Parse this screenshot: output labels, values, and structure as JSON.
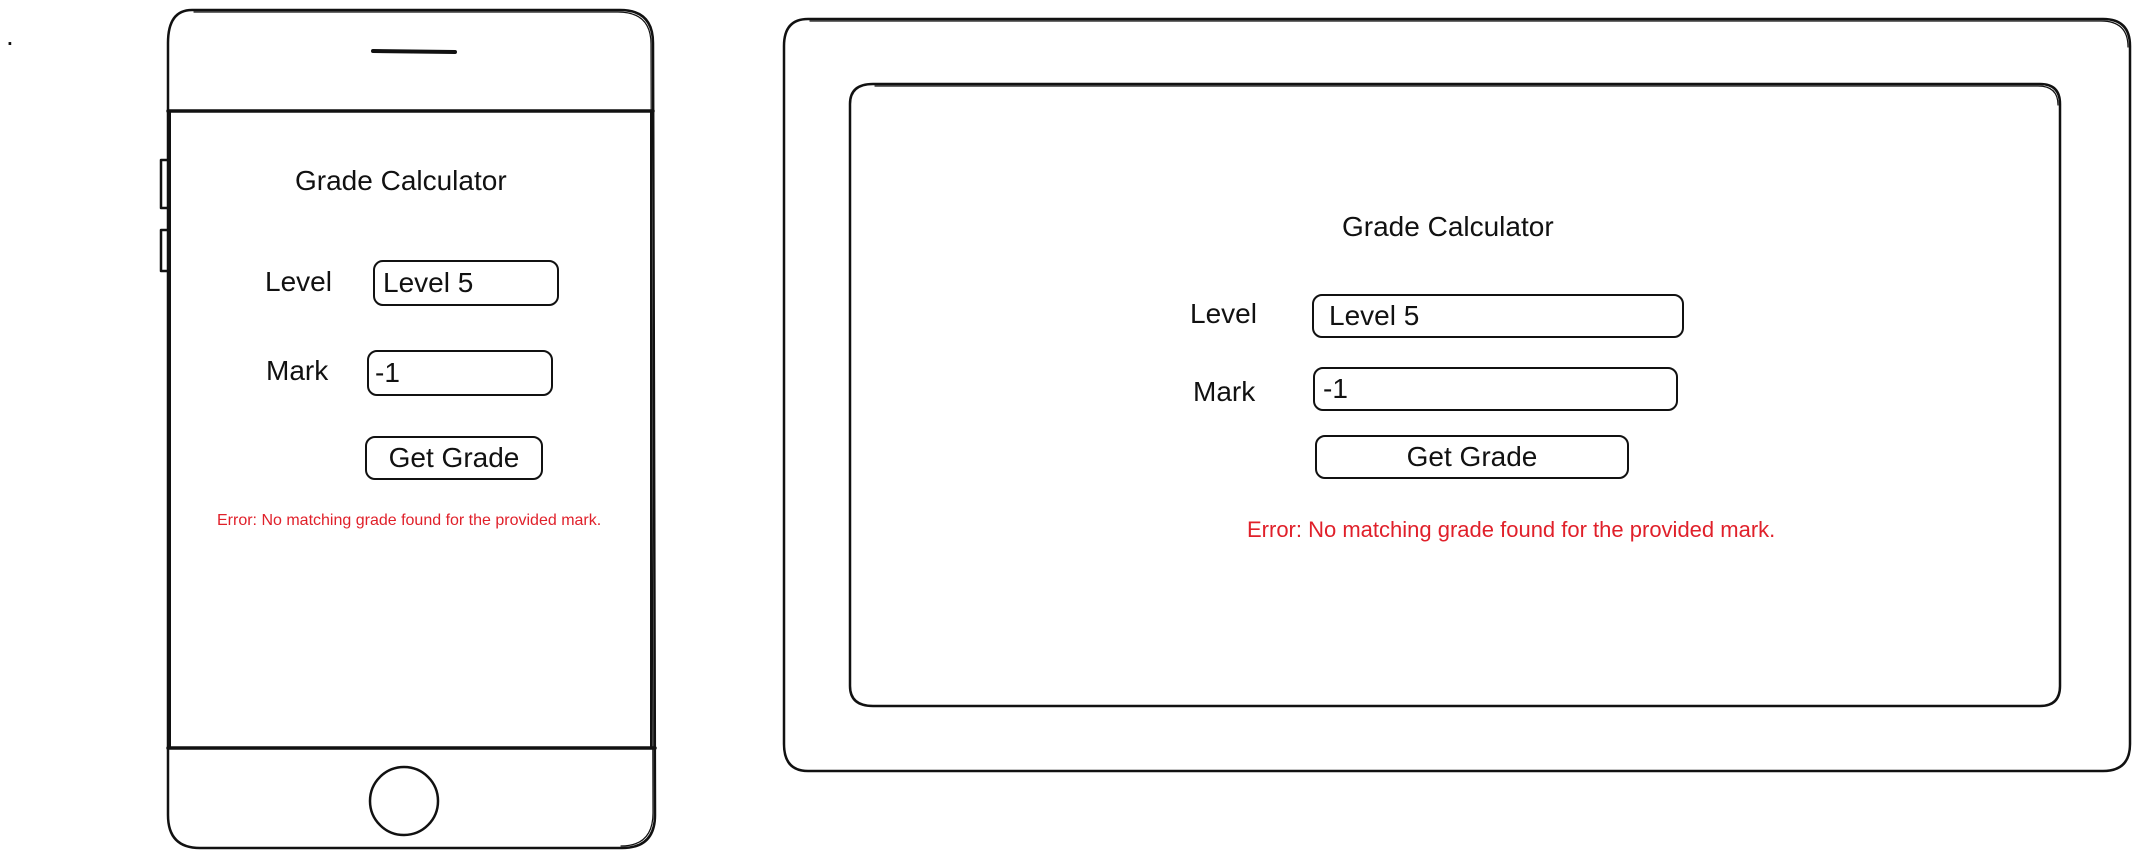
{
  "stray_mark": ".",
  "phone": {
    "title": "Grade Calculator",
    "level_label": "Level",
    "level_value": "Level 5",
    "mark_label": "Mark",
    "mark_value": "-1",
    "button_label": "Get Grade",
    "error_text": "Error: No matching grade found for the provided mark."
  },
  "tablet": {
    "title": "Grade Calculator",
    "level_label": "Level",
    "level_value": "Level 5",
    "mark_label": "Mark",
    "mark_value": "-1",
    "button_label": "Get Grade",
    "error_text": "Error: No matching grade found for the provided mark."
  },
  "colors": {
    "error": "#e0202a",
    "stroke": "#111111"
  }
}
